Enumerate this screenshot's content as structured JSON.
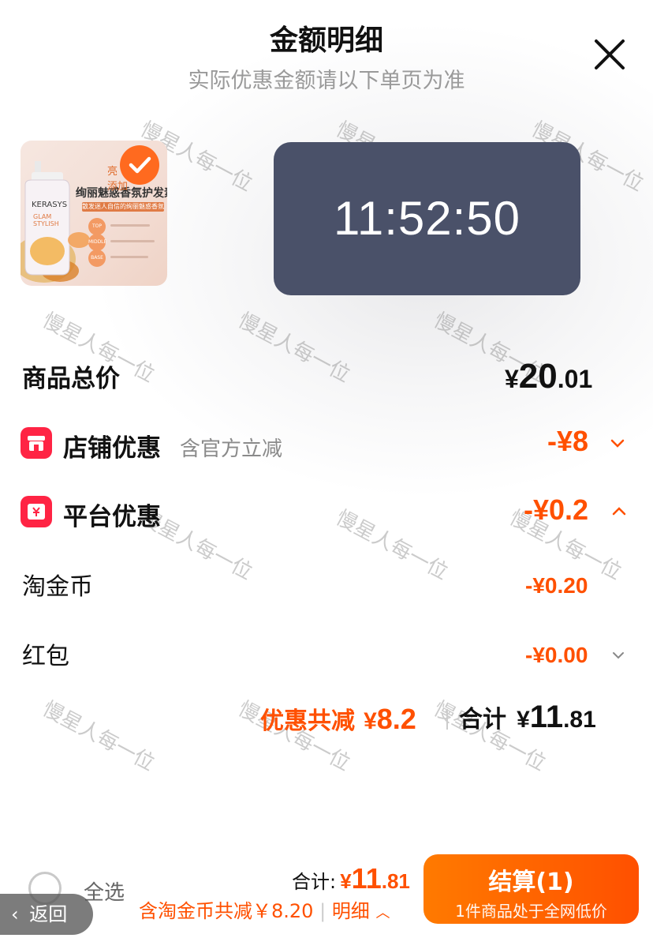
{
  "header": {
    "title": "金额明细",
    "subtitle": "实际优惠金额请以下单页为准"
  },
  "product": {
    "brand": "KERASYS",
    "line": "GLAM STYLISH",
    "headline": "绚丽魅惑香氛护发素",
    "sub": "散发迷人自信的绚丽魅惑香氛",
    "notes": [
      "TOP",
      "MIDDLE",
      "BASE"
    ],
    "corner_text": "亮 添加"
  },
  "clock": {
    "time": "11:52:50"
  },
  "total_price": {
    "label": "商品总价",
    "currency": "¥",
    "integer": "20",
    "decimal": ".01"
  },
  "shop_discount": {
    "label": "店铺优惠",
    "note": "含官方立减",
    "amount": "-¥8"
  },
  "platform_discount": {
    "label": "平台优惠",
    "amount": "-¥0.2"
  },
  "taojinbi": {
    "label": "淘金币",
    "amount": "-¥0.20"
  },
  "hongbao": {
    "label": "红包",
    "amount": "-¥0.00"
  },
  "summary": {
    "discount_label": "优惠共减",
    "discount_currency": "¥",
    "discount_value": "8.2",
    "total_label": "合计",
    "total_currency": "¥",
    "total_integer": "11",
    "total_decimal": ".81"
  },
  "bottom": {
    "select_all": "全选",
    "back": "返回",
    "total_label": "合计:",
    "total_currency": "¥",
    "total_integer": "11",
    "total_decimal": ".81",
    "coin_note": "含淘金币共减￥8.20",
    "detail_label": "明细",
    "checkout_label": "结算(1)",
    "checkout_sub": "1件商品处于全网低价"
  },
  "watermark": "慢星人每一位",
  "colors": {
    "accent": "#ff5000",
    "icon_red": "#ff2444",
    "clock_bg": "#4a5169"
  },
  "icons": [
    "close-icon",
    "check-icon",
    "shop-icon",
    "platform-coupon-icon",
    "chevron-down-icon",
    "chevron-up-icon",
    "back-arrow-icon",
    "radio-icon"
  ]
}
